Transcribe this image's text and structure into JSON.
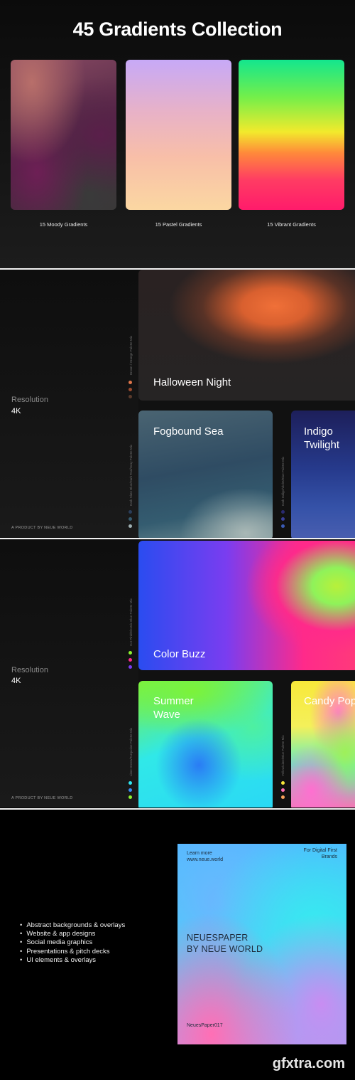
{
  "header": {
    "title": "45 Gradients Collection"
  },
  "collection": {
    "cards": [
      {
        "label": "15 Moody Gradients"
      },
      {
        "label": "15 Pastel Gradients"
      },
      {
        "label": "15 Vibrant Gradients"
      }
    ]
  },
  "panel1": {
    "resolution_label": "Resolution",
    "resolution_value": "4K",
    "product": "A PRODUCT BY NEUE WORLD",
    "tiles": [
      {
        "title": "Halloween Night",
        "palette": "Brown / Orange Palette Mix",
        "dots": [
          "#e0764a",
          "#9b4a2e",
          "#5a3b2c"
        ]
      },
      {
        "title": "Fogbound Sea",
        "palette": "Dark Slate Blue/Dark Teal/Gray Palette Mix",
        "dots": [
          "#2a3d5a",
          "#355a6e",
          "#9fb0b3"
        ]
      },
      {
        "title": "Indigo Twilight",
        "palette": "Dark Indigo/Violet/Blue Palette Mix",
        "dots": [
          "#2a2a70",
          "#3a3f9a",
          "#3b5bb5"
        ]
      }
    ]
  },
  "panel2": {
    "resolution_label": "Resolution",
    "resolution_value": "4K",
    "product": "A PRODUCT BY NEUE WORLD",
    "tiles": [
      {
        "title": "Color Buzz",
        "palette": "Hot Pink/Electric Blue Palette Mix",
        "dots": [
          "#8cf22e",
          "#ff2a8a",
          "#7a3df0"
        ]
      },
      {
        "title": "Summer Wave",
        "palette": "Lime Green/Turquoise Palette Mix",
        "dots": [
          "#2ee6f0",
          "#3a8cf5",
          "#8cf22e"
        ]
      },
      {
        "title": "Candy Pop",
        "palette": "Yellow/Lime/Blue Palette Mix",
        "dots": [
          "#f8e83a",
          "#ff6fb5",
          "#f7a25a"
        ]
      }
    ]
  },
  "features": [
    "Abstract backgrounds & overlays",
    "Website & app designs",
    "Social media graphics",
    "Presentations & pitch decks",
    "UI elements & overlays"
  ],
  "poster": {
    "learn_more": "Learn more",
    "url": "www.neue.world",
    "tag_line1": "For Digital First",
    "tag_line2": "Brands",
    "main_line1": "NEUESPAPER",
    "main_line2": "BY NEUE WORLD",
    "code": "NeuesPaper017"
  },
  "watermark": {
    "text": "gfxtra.com"
  }
}
